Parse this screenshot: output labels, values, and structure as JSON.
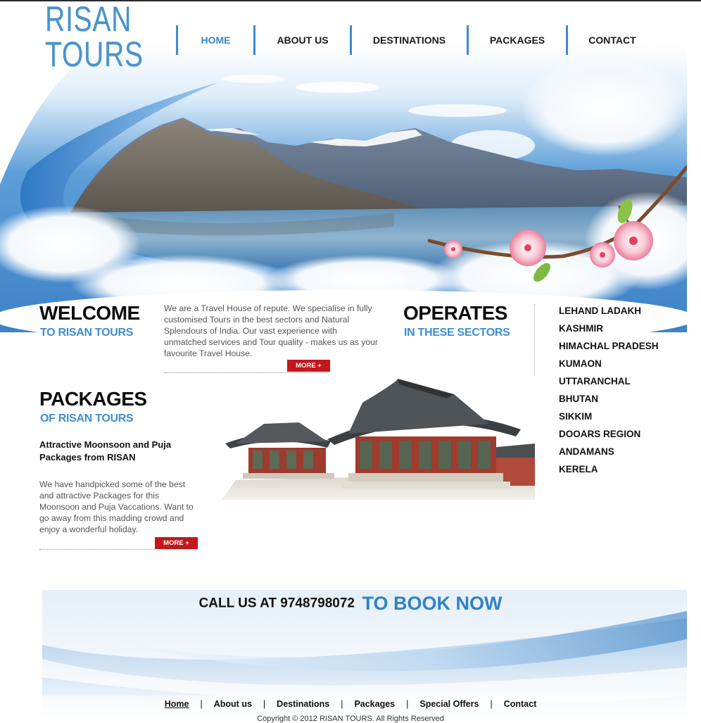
{
  "brand": {
    "line1": "RISAN",
    "line2": "TOURS",
    "color": "#4a93cc"
  },
  "nav": {
    "items": [
      {
        "label": "HOME",
        "active": true
      },
      {
        "label": "ABOUT US",
        "active": false
      },
      {
        "label": "DESTINATIONS",
        "active": false
      },
      {
        "label": "PACKAGES",
        "active": false
      },
      {
        "label": "CONTACT",
        "active": false
      }
    ]
  },
  "welcome": {
    "title": "WELCOME",
    "subtitle": "TO RISAN TOURS",
    "text": "We are a Travel House of repute. We specialise in fully customised Tours in the best sectors and Natural Splendours of India. Our vast experience with unmatched services and Tour quality - makes us as your favourite Travel House.",
    "more_label": "MORE +"
  },
  "operates": {
    "title": "OPERATES",
    "subtitle": "IN THESE SECTORS",
    "sectors": [
      "LEHAND LADAKH",
      "KASHMIR",
      "HIMACHAL PRADESH",
      "KUMAON",
      "UTTARANCHAL",
      "BHUTAN",
      "SIKKIM",
      "DOOARS REGION",
      "ANDAMANS",
      "KERELA"
    ]
  },
  "packages": {
    "title": "PACKAGES",
    "subtitle": "OF RISAN TOURS",
    "headline": "Attractive Moonsoon and Puja Packages from RISAN",
    "text": "We have handpicked some of the best and attractive Packages for this Moonsoon and Puja Vaccations. Want to go away from this madding crowd and enjoy a wonderful holiday.",
    "more_label": "MORE +"
  },
  "call": {
    "text": "CALL US AT 9748798072",
    "cta": "TO BOOK NOW"
  },
  "footer": {
    "links": [
      {
        "label": "Home",
        "active": true
      },
      {
        "label": "About us",
        "active": false
      },
      {
        "label": "Destinations",
        "active": false
      },
      {
        "label": "Packages",
        "active": false
      },
      {
        "label": "Special Offers",
        "active": false
      },
      {
        "label": "Contact",
        "active": false
      }
    ],
    "separator": "|",
    "copyright": "Copyright © 2012 RISAN TOURS. All Rights Reserved"
  },
  "colors": {
    "accent": "#3d8fd0",
    "button": "#c4161c",
    "text": "#111111"
  }
}
